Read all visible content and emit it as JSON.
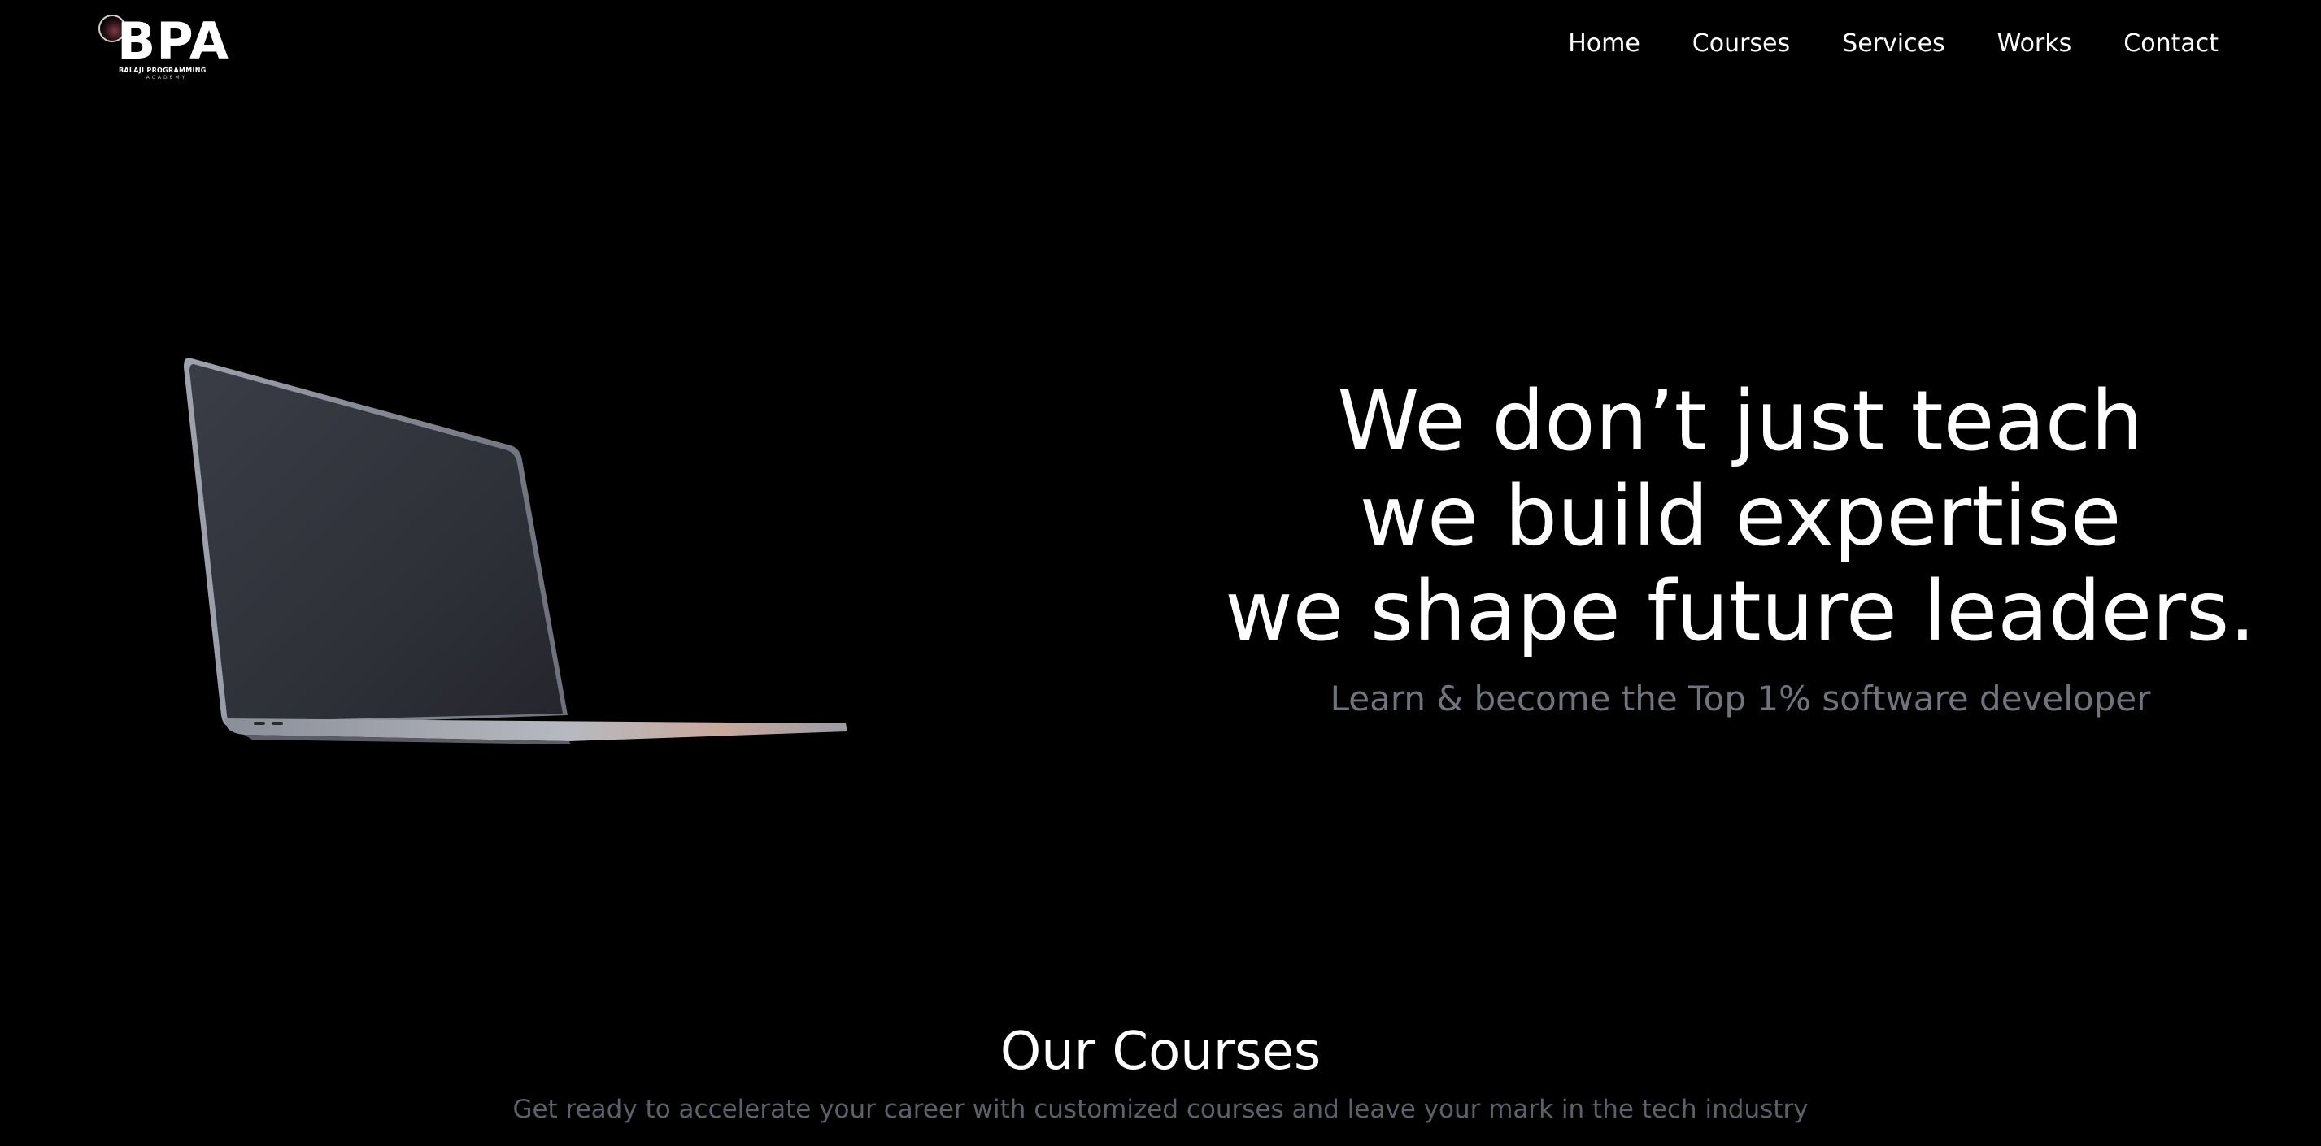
{
  "header": {
    "logo": {
      "mark": "BPA",
      "subtitle": "BALAJI PROGRAMMING",
      "subtitle2": "ACADEMY"
    },
    "nav": [
      {
        "label": "Home"
      },
      {
        "label": "Courses"
      },
      {
        "label": "Services"
      },
      {
        "label": "Works"
      },
      {
        "label": "Contact"
      }
    ]
  },
  "hero": {
    "headline": [
      "We don’t just teach",
      "we build expertise",
      "we shape future leaders."
    ],
    "tagline": "Learn & become the Top 1% software developer"
  },
  "courses": {
    "title": "Our Courses",
    "subtitle": "Get ready to accelerate your career with customized courses and leave your mark in the tech industry"
  },
  "colors": {
    "background": "#000000",
    "text": "#ffffff",
    "muted": "#6f747d"
  }
}
